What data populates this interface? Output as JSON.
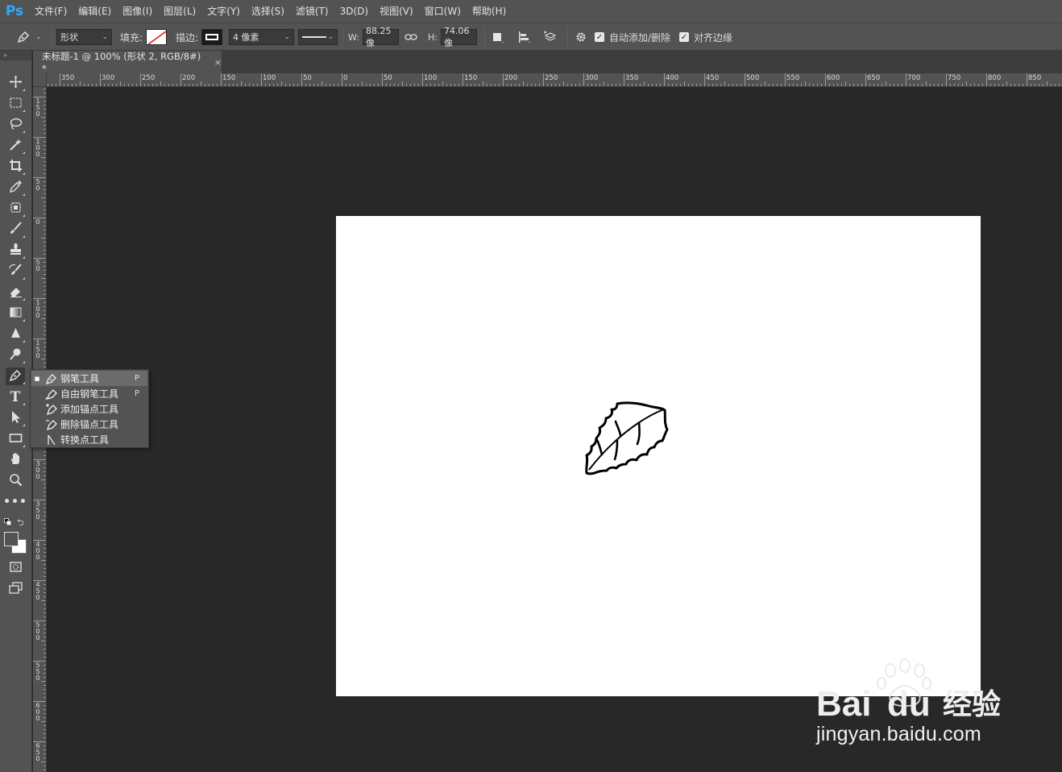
{
  "app": {
    "logo": "Ps"
  },
  "menu": [
    "文件(F)",
    "编辑(E)",
    "图像(I)",
    "图层(L)",
    "文字(Y)",
    "选择(S)",
    "滤镜(T)",
    "3D(D)",
    "视图(V)",
    "窗口(W)",
    "帮助(H)"
  ],
  "options": {
    "mode_value": "形状",
    "fill_label": "填充:",
    "stroke_label": "描边:",
    "stroke_width": "4 像素",
    "w_label": "W:",
    "w_value": "88.25 像",
    "h_label": "H:",
    "h_value": "74.06 像",
    "auto_add_delete": "自动添加/删除",
    "align_edges": "对齐边缘"
  },
  "document": {
    "tab_title": "未标题-1 @ 100% (形状 2, RGB/8#) *",
    "close": "×"
  },
  "ruler_h": [
    "350",
    "300",
    "250",
    "200",
    "150",
    "100",
    "50",
    "0",
    "50",
    "100",
    "150",
    "200",
    "250",
    "300",
    "350",
    "400",
    "450",
    "500",
    "550",
    "600",
    "650",
    "700",
    "750",
    "800",
    "850"
  ],
  "ruler_v": [
    "150",
    "100",
    "50",
    "0",
    "50",
    "100",
    "150",
    "200",
    "250",
    "300",
    "350",
    "400",
    "450",
    "500",
    "550",
    "600",
    "650"
  ],
  "flyout": {
    "items": [
      {
        "label": "钢笔工具",
        "key": "P",
        "selected": true,
        "icon": "pen-icon"
      },
      {
        "label": "自由钢笔工具",
        "key": "P",
        "selected": false,
        "icon": "freeform-pen-icon"
      },
      {
        "label": "添加锚点工具",
        "key": "",
        "selected": false,
        "icon": "add-anchor-icon"
      },
      {
        "label": "删除锚点工具",
        "key": "",
        "selected": false,
        "icon": "delete-anchor-icon"
      },
      {
        "label": "转换点工具",
        "key": "",
        "selected": false,
        "icon": "convert-point-icon"
      }
    ]
  },
  "watermark": {
    "brand": "Bai",
    "brand2": "du",
    "cn": "经验",
    "url": "jingyan.baidu.com"
  },
  "colors": {
    "accent": "#31a8ff",
    "panel": "#535353",
    "workspace": "#282828",
    "canvas": "#ffffff"
  }
}
